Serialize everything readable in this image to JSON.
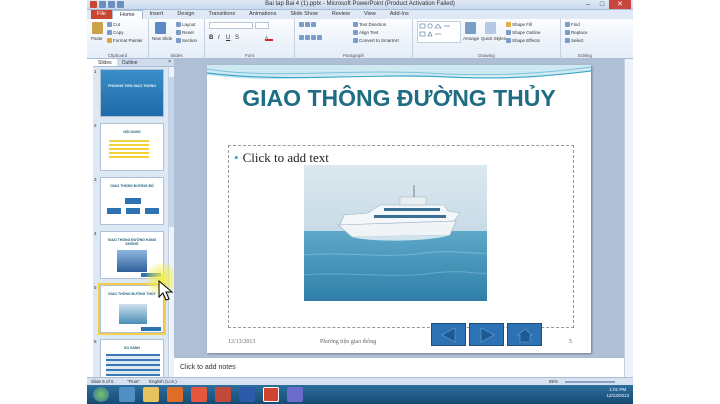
{
  "window": {
    "title": "Bai tap Bai 4 (1).pptx - Microsoft PowerPoint (Product Activation Failed)",
    "controls": [
      "–",
      "□",
      "✕"
    ]
  },
  "tabs": [
    "File",
    "Home",
    "Insert",
    "Design",
    "Transitions",
    "Animations",
    "Slide Show",
    "Review",
    "View",
    "Add-Ins"
  ],
  "ribbon": {
    "clipboard": {
      "label": "Clipboard",
      "paste": "Paste",
      "cut": "Cut",
      "copy": "Copy",
      "format_painter": "Format Painter"
    },
    "slides": {
      "label": "Slides",
      "new_slide": "New Slide",
      "layout": "Layout",
      "reset": "Reset",
      "section": "Section"
    },
    "font": {
      "label": "Font"
    },
    "paragraph": {
      "label": "Paragraph",
      "text_direction": "Text Direction",
      "align_text": "Align Text",
      "convert_smartart": "Convert to SmartArt"
    },
    "drawing": {
      "label": "Drawing",
      "arrange": "Arrange",
      "quick_styles": "Quick Styles",
      "shape_fill": "Shape Fill",
      "shape_outline": "Shape Outline",
      "shape_effects": "Shape Effects"
    },
    "editing": {
      "label": "Editing",
      "find": "Find",
      "replace": "Replace",
      "select": "Select"
    }
  },
  "panel": {
    "tab_slides": "Slides",
    "tab_outline": "Outline",
    "close": "×",
    "thumbs": [
      {
        "num": "1",
        "title": "PHUONG TIEN GIAO THONG"
      },
      {
        "num": "2",
        "title": "NỘI DUNG"
      },
      {
        "num": "3",
        "title": "GIAO THÔNG ĐƯỜNG BỘ"
      },
      {
        "num": "4",
        "title": "GIAO THÔNG ĐƯỜNG HÀNG KHÔNG"
      },
      {
        "num": "5",
        "title": "GIAO THÔNG ĐƯỜNG THỦY"
      },
      {
        "num": "6",
        "title": "SO SÁNH"
      }
    ]
  },
  "slide": {
    "title": "GIAO THÔNG ĐƯỜNG THỦY",
    "placeholder": "Click to add text",
    "footer_date": "12/13/2013",
    "footer_text": "Phương tiện giao thông",
    "slide_number": "5"
  },
  "notes": {
    "placeholder": "Click to add notes"
  },
  "status": {
    "slide_info": "Slide 5 of 6",
    "theme": "\"Flow\"",
    "language": "English (U.S.)",
    "zoom": "85%"
  },
  "taskbar": {
    "time": "1:01 PM",
    "date": "12/13/2013"
  },
  "colors": {
    "title": "#1f6d84",
    "accent": "#31a6c6",
    "nav_button": "#2d73b3",
    "file_tab": "#c8452f"
  }
}
